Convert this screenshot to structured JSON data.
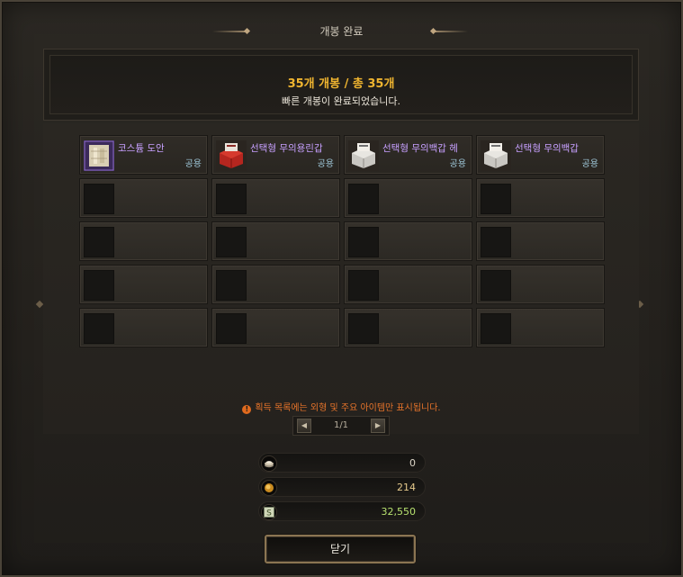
{
  "window": {
    "title": "개봉 완료"
  },
  "summary": {
    "count_text": "35개 개봉 / 총 35개",
    "message": "빠른 개봉이 완료되었습니다."
  },
  "items": [
    {
      "name": "코스튬 도안",
      "share": "공용",
      "icon": "costume-blueprint-icon"
    },
    {
      "name": "선택형 무의용린갑",
      "share": "공용",
      "icon": "red-armor-box-icon"
    },
    {
      "name": "선택형 무의백갑 헤",
      "share": "공용",
      "icon": "white-armor-box-icon"
    },
    {
      "name": "선택형 무의백갑",
      "share": "공용",
      "icon": "white-armor-box-icon"
    }
  ],
  "empty_slot_count": 16,
  "notice": {
    "icon": "!",
    "text": "획득 목록에는 외형 및 주요 아이템만 표시됩니다."
  },
  "pagination": {
    "current": 1,
    "total": 1,
    "text": "1/1"
  },
  "currencies": [
    {
      "name": "coin",
      "value": "0",
      "icon": "coin-stack-icon",
      "color": "#ddd6c8"
    },
    {
      "name": "gold",
      "value": "214",
      "icon": "gold-icon",
      "color": "#e5c98c"
    },
    {
      "name": "cera",
      "value": "32,550",
      "icon": "cera-icon",
      "color": "#b7e16f"
    }
  ],
  "close_button": {
    "label": "닫기"
  },
  "colors": {
    "summary_count": "#f0b530",
    "item_name": "#c7a0ff",
    "share_label": "#9fc8d9",
    "notice": "#e6732a",
    "button_border": "#8b7552"
  }
}
